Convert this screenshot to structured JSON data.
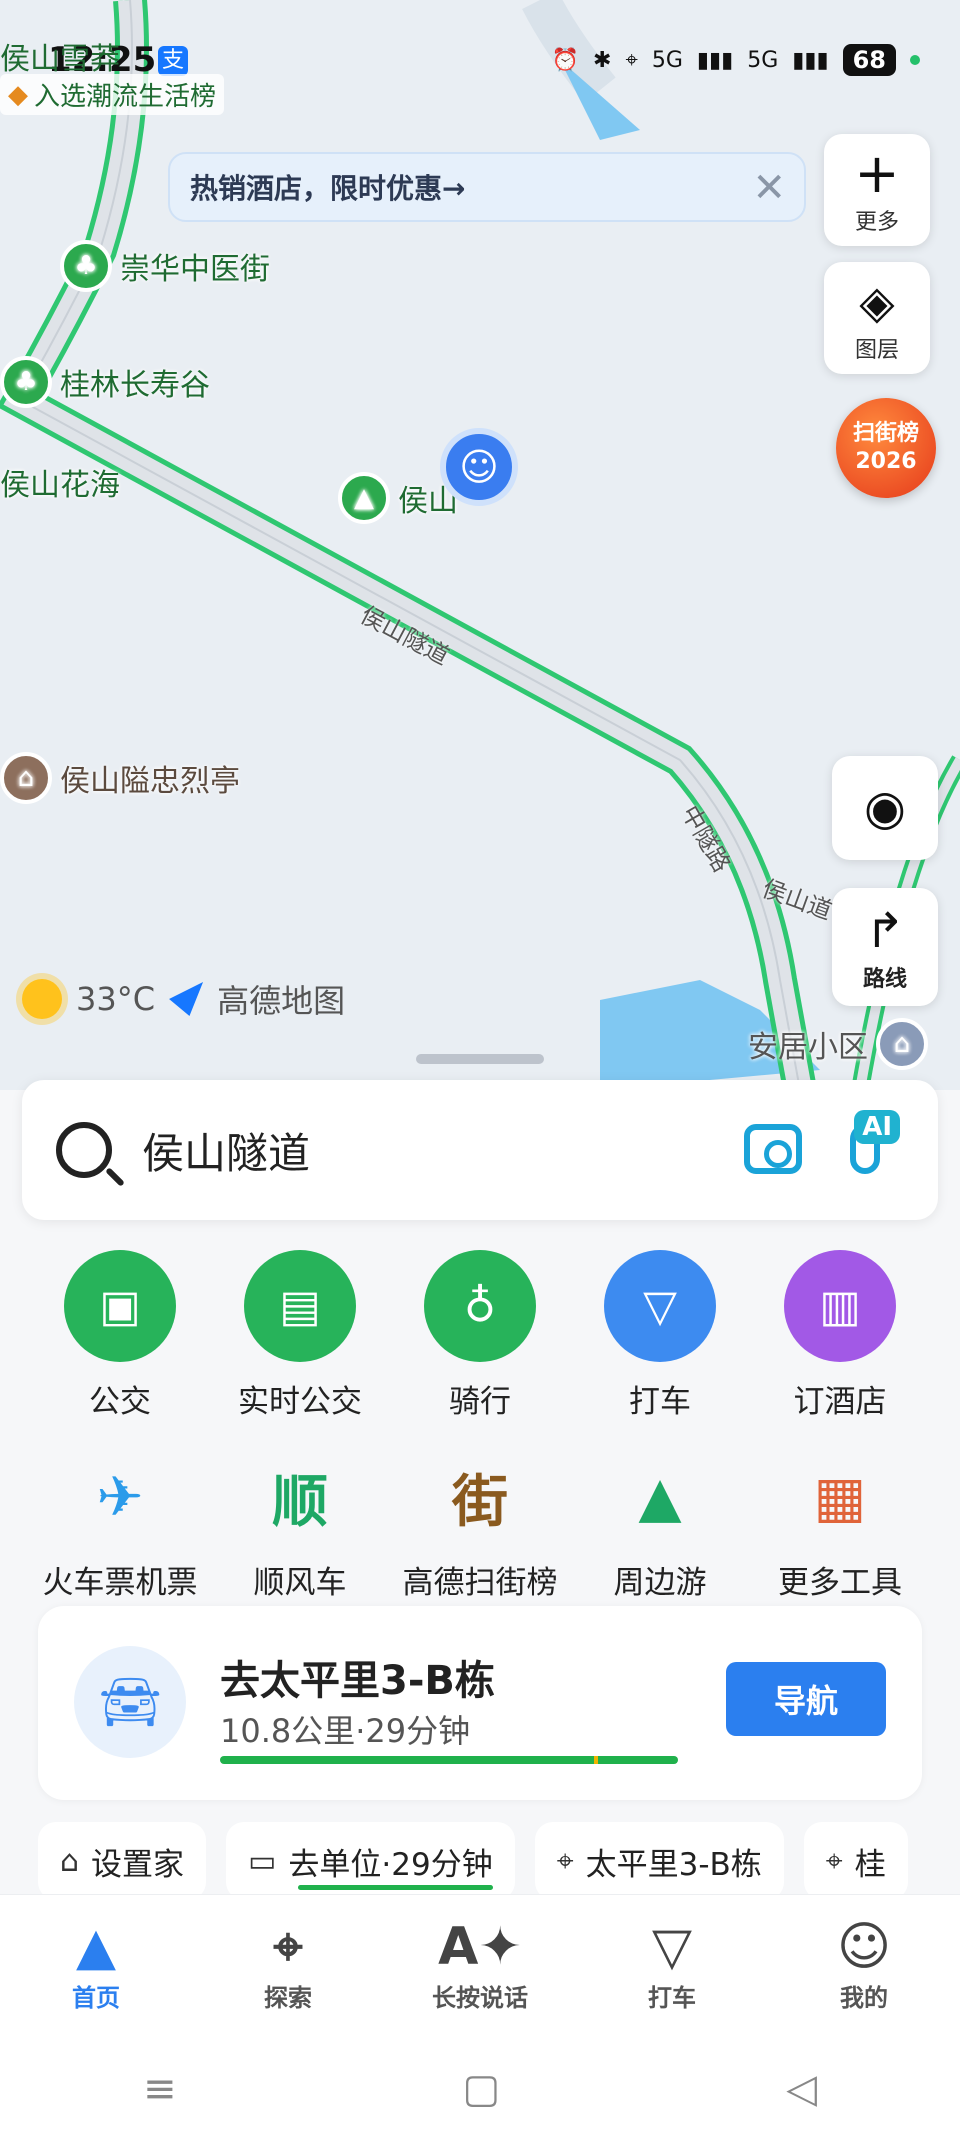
{
  "status_bar": {
    "time": "12:25",
    "pay_icon": "alipay-icon",
    "network_1": "5G",
    "network_2": "5G",
    "battery": "68"
  },
  "map": {
    "top_label": "侯山雪莽",
    "trend_label": "入选潮流生活榜",
    "promo_text": "热销酒店，限时优惠→",
    "pois": [
      {
        "name": "崇华中医街",
        "icon": "tree-icon"
      },
      {
        "name": "桂林长寿谷",
        "icon": "tree-icon"
      },
      {
        "name": "侯山花海",
        "icon": "none"
      },
      {
        "name": "侯山",
        "icon": "mountain-icon"
      },
      {
        "name": "侯山隘忠烈亭",
        "icon": "pavilion-icon"
      },
      {
        "name": "安居小区",
        "icon": "building-icon"
      }
    ],
    "roads": [
      "侯山隧道",
      "中隧路",
      "侯山道"
    ],
    "controls": {
      "more_label": "更多",
      "layers_label": "图层",
      "route_label": "路线"
    },
    "badge": {
      "line1": "扫街榜",
      "line2": "2026"
    },
    "weather": {
      "temperature": "33°C",
      "brand": "高德地图"
    }
  },
  "search": {
    "query": "侯山隧道",
    "ai_badge": "AI"
  },
  "tools_row1": [
    {
      "label": "公交",
      "icon": "bus-icon",
      "color": "#27b35a"
    },
    {
      "label": "实时公交",
      "icon": "realtime-bus-icon",
      "color": "#27b35a"
    },
    {
      "label": "骑行",
      "icon": "bike-icon",
      "color": "#27b35a"
    },
    {
      "label": "打车",
      "icon": "taxi-icon",
      "color": "#3d8bf0"
    },
    {
      "label": "订酒店",
      "icon": "hotel-icon",
      "color": "#a259e6"
    }
  ],
  "tools_row2": [
    {
      "label": "火车票机票",
      "icon": "train-icon",
      "glyph": "✈"
    },
    {
      "label": "顺风车",
      "icon": "ride-share-icon",
      "glyph": "顺"
    },
    {
      "label": "高德扫街榜",
      "icon": "street-rank-icon",
      "glyph": "街"
    },
    {
      "label": "周边游",
      "icon": "nearby-tour-icon",
      "glyph": "▲"
    },
    {
      "label": "更多工具",
      "icon": "more-tools-icon",
      "glyph": "▦"
    }
  ],
  "route_card": {
    "destination": "去太平里3-B栋",
    "info": "10.8公里·29分钟",
    "nav_button": "导航"
  },
  "chips": [
    "设置家",
    "去单位·29分钟",
    "太平里3-B栋",
    "桂"
  ],
  "tabs": [
    {
      "label": "首页",
      "icon": "home-arrow-icon"
    },
    {
      "label": "探索",
      "icon": "explore-pin-icon"
    },
    {
      "label": "长按说话",
      "icon": "ai-voice-icon"
    },
    {
      "label": "打车",
      "icon": "taxi-icon"
    },
    {
      "label": "我的",
      "icon": "profile-icon"
    }
  ]
}
